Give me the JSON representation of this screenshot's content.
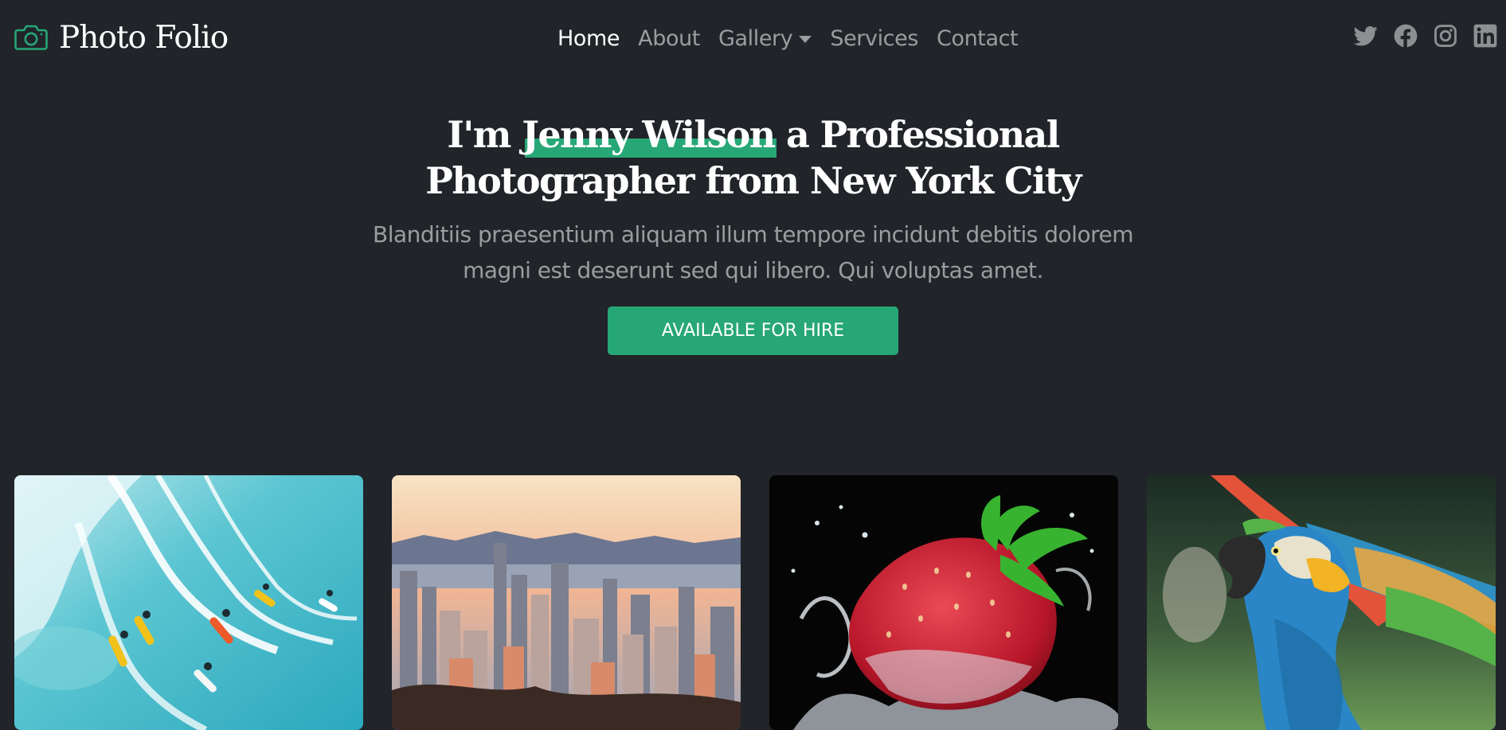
{
  "brand": {
    "name": "Photo Folio",
    "icon": "camera-icon",
    "accent": "#27a776"
  },
  "nav": {
    "items": [
      {
        "label": "Home",
        "active": true
      },
      {
        "label": "About"
      },
      {
        "label": "Gallery",
        "dropdown": true
      },
      {
        "label": "Services"
      },
      {
        "label": "Contact"
      }
    ]
  },
  "social": [
    "twitter-icon",
    "facebook-icon",
    "instagram-icon",
    "linkedin-icon"
  ],
  "hero": {
    "title_prefix": "I'm ",
    "title_name": "Jenny Wilson",
    "title_suffix": " a Professional Photographer from New York City",
    "subtitle": "Blanditiis praesentium aliquam illum tempore incidunt debitis dolorem magni est deserunt sed qui libero. Qui voluptas amet.",
    "cta_label": "AVAILABLE FOR HIRE"
  },
  "gallery": [
    {
      "subject": "surfers-photo"
    },
    {
      "subject": "city-skyline-photo"
    },
    {
      "subject": "strawberry-splash-photo"
    },
    {
      "subject": "macaw-parrot-photo"
    }
  ],
  "colors": {
    "background": "#212429",
    "text_muted": "rgba(255,255,255,0.55)"
  }
}
